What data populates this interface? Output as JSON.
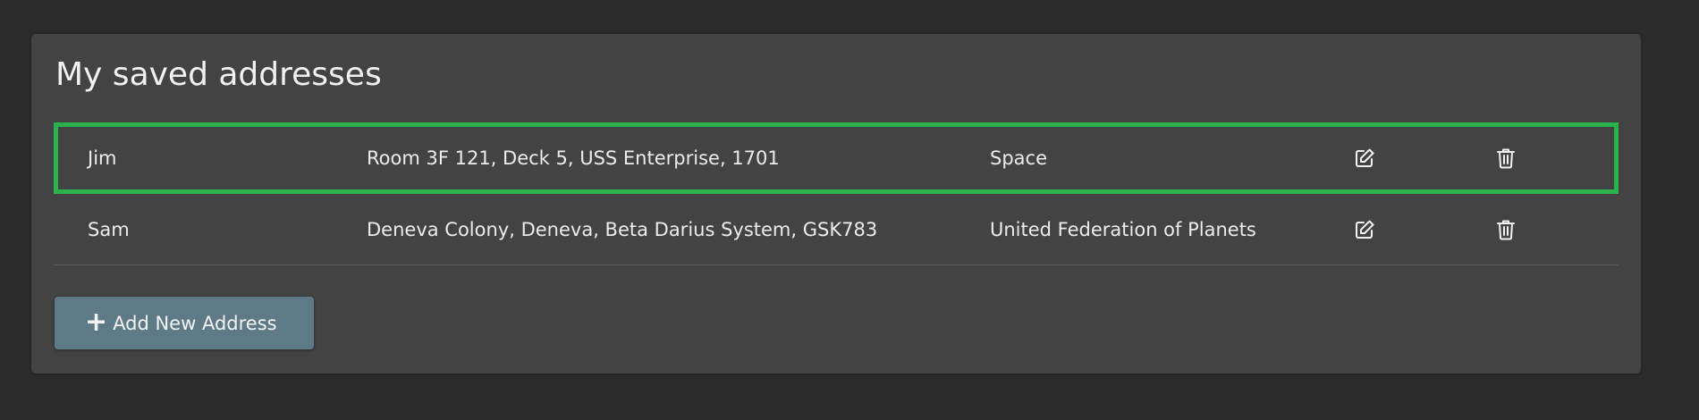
{
  "page": {
    "title": "My saved addresses"
  },
  "addresses": [
    {
      "name": "Jim",
      "address": "Room 3F 121, Deck 5, USS Enterprise, 1701",
      "region": "Space",
      "selected": true,
      "edit_icon": "edit-icon",
      "delete_icon": "trash-icon"
    },
    {
      "name": "Sam",
      "address": "Deneva Colony, Deneva, Beta Darius System, GSK783",
      "region": "United Federation of Planets",
      "selected": false,
      "edit_icon": "edit-icon",
      "delete_icon": "trash-icon"
    }
  ],
  "actions": {
    "add_label": "Add New Address",
    "add_icon": "plus-icon"
  },
  "colors": {
    "background": "#2b2b2b",
    "panel": "#434343",
    "selection_border": "#2bb24c",
    "button": "#5e7a87",
    "text": "#ececec"
  }
}
